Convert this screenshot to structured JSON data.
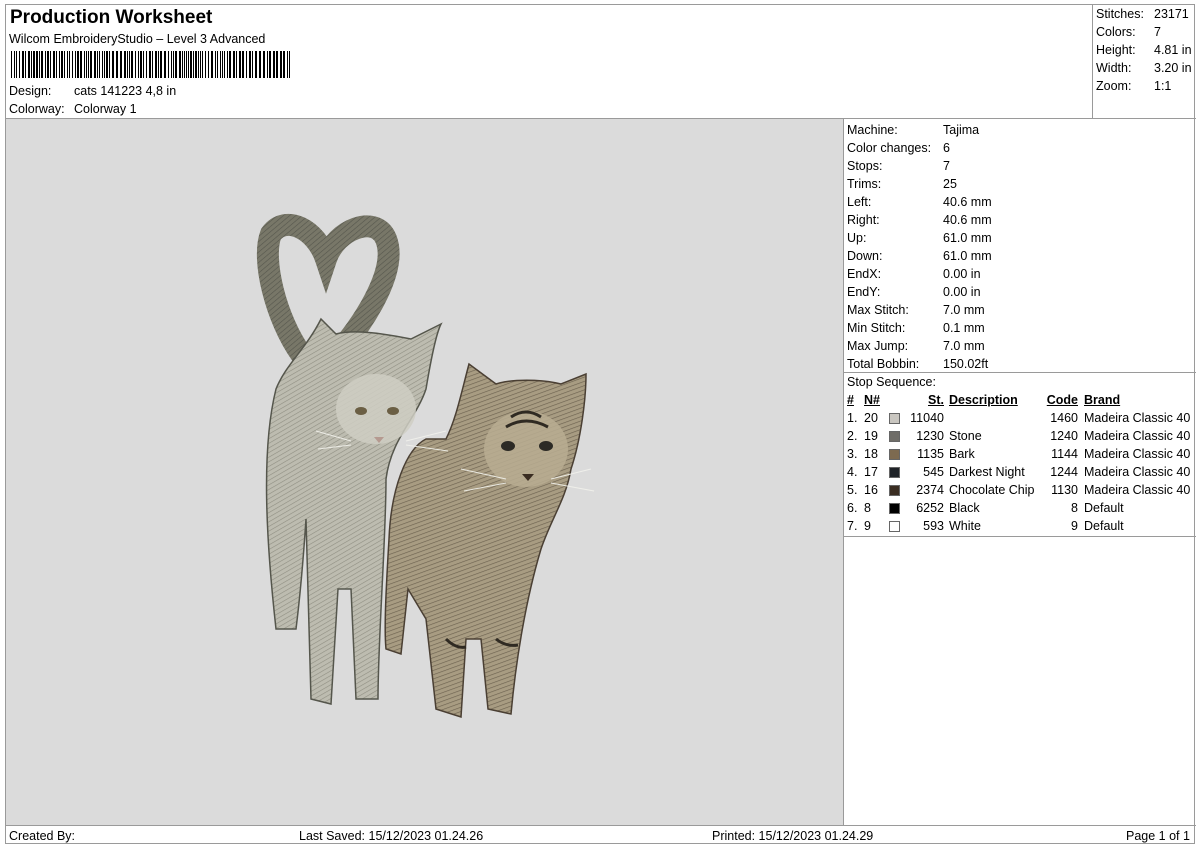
{
  "header": {
    "title": "Production Worksheet",
    "subtitle": "Wilcom EmbroideryStudio – Level 3 Advanced",
    "design_label": "Design:",
    "design_value": "cats 141223 4,8 in",
    "colorway_label": "Colorway:",
    "colorway_value": "Colorway 1"
  },
  "stats": [
    {
      "label": "Stitches:",
      "value": "23171"
    },
    {
      "label": "Colors:",
      "value": "7"
    },
    {
      "label": "Height:",
      "value": "4.81 in"
    },
    {
      "label": "Width:",
      "value": "3.20 in"
    },
    {
      "label": "Zoom:",
      "value": "1:1"
    }
  ],
  "machine_info": [
    {
      "label": "Machine:",
      "value": "Tajima"
    },
    {
      "label": "Color changes:",
      "value": "6"
    },
    {
      "label": "Stops:",
      "value": "7"
    },
    {
      "label": "Trims:",
      "value": "25"
    },
    {
      "label": "Left:",
      "value": "40.6 mm"
    },
    {
      "label": "Right:",
      "value": "40.6 mm"
    },
    {
      "label": "Up:",
      "value": "61.0 mm"
    },
    {
      "label": "Down:",
      "value": "61.0 mm"
    },
    {
      "label": "EndX:",
      "value": "0.00 in"
    },
    {
      "label": "EndY:",
      "value": "0.00 in"
    },
    {
      "label": "Max Stitch:",
      "value": "7.0 mm"
    },
    {
      "label": "Min Stitch:",
      "value": "0.1 mm"
    },
    {
      "label": "Max Jump:",
      "value": "7.0 mm"
    },
    {
      "label": "Total Bobbin:",
      "value": "150.02ft"
    }
  ],
  "stop_sequence": {
    "title": "Stop Sequence:",
    "headers": {
      "num": "#",
      "n": "N#",
      "st": "St.",
      "desc": "Description",
      "code": "Code",
      "brand": "Brand"
    },
    "rows": [
      {
        "num": "1.",
        "n": "20",
        "color": "#c9c6c0",
        "st": "11040",
        "desc": "",
        "code": "1460",
        "brand": "Madeira Classic 40"
      },
      {
        "num": "2.",
        "n": "19",
        "color": "#6f6d68",
        "st": "1230",
        "desc": "Stone",
        "code": "1240",
        "brand": "Madeira Classic 40"
      },
      {
        "num": "3.",
        "n": "18",
        "color": "#7d6a50",
        "st": "1135",
        "desc": "Bark",
        "code": "1144",
        "brand": "Madeira Classic 40"
      },
      {
        "num": "4.",
        "n": "17",
        "color": "#1f2328",
        "st": "545",
        "desc": "Darkest Night",
        "code": "1244",
        "brand": "Madeira Classic 40"
      },
      {
        "num": "5.",
        "n": "16",
        "color": "#3a2d22",
        "st": "2374",
        "desc": "Chocolate Chip",
        "code": "1130",
        "brand": "Madeira Classic 40"
      },
      {
        "num": "6.",
        "n": "8",
        "color": "#000000",
        "st": "6252",
        "desc": "Black",
        "code": "8",
        "brand": "Default"
      },
      {
        "num": "7.",
        "n": "9",
        "color": "#ffffff",
        "st": "593",
        "desc": "White",
        "code": "9",
        "brand": "Default"
      }
    ]
  },
  "footer": {
    "created_by": "Created By:",
    "last_saved": "Last Saved: 15/12/2023 01.24.26",
    "printed": "Printed: 15/12/2023 01.24.29",
    "page": "Page 1 of 1"
  }
}
